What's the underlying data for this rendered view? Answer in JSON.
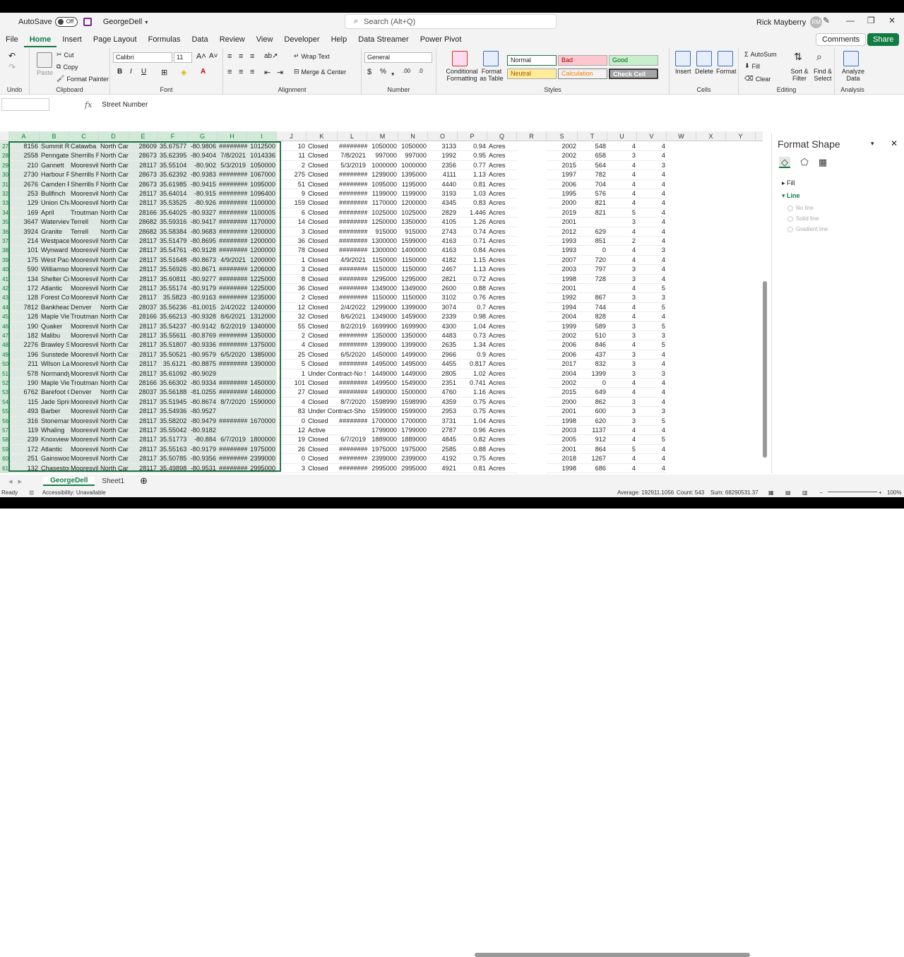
{
  "titlebar": {
    "autosave_label": "AutoSave",
    "autosave_state": "Off",
    "doc_name": "GeorgeDell",
    "search_placeholder": "Search (Alt+Q)",
    "user_name": "Rick Mayberry",
    "user_initials": "RM"
  },
  "tabs": [
    "File",
    "Home",
    "Insert",
    "Page Layout",
    "Formulas",
    "Data",
    "Review",
    "View",
    "Developer",
    "Help",
    "Data Streamer",
    "Power Pivot"
  ],
  "comments_label": "Comments",
  "share_label": "Share",
  "ribbon": {
    "undo": "Undo",
    "paste": "Paste",
    "cut": "Cut",
    "copy": "Copy",
    "format_painter": "Format Painter",
    "clipboard": "Clipboard",
    "font_name": "Calibri",
    "font_size": "11",
    "font": "Font",
    "wrap_text": "Wrap Text",
    "merge_center": "Merge & Center",
    "alignment": "Alignment",
    "number_format": "General",
    "number": "Number",
    "cond_format": "Conditional Formatting",
    "format_as_table": "Format as Table",
    "style_normal": "Normal",
    "style_bad": "Bad",
    "style_good": "Good",
    "style_neutral": "Neutral",
    "style_calculation": "Calculation",
    "style_check": "Check Cell",
    "styles": "Styles",
    "insert": "Insert",
    "delete": "Delete",
    "format": "Format",
    "cells": "Cells",
    "autosum": "AutoSum",
    "fill": "Fill",
    "clear": "Clear",
    "sort_filter": "Sort & Filter",
    "find_select": "Find & Select",
    "editing": "Editing",
    "analyze_data": "Analyze Data",
    "analysis": "Analysis"
  },
  "formula_bar": {
    "fx": "fx",
    "value": "Street Number"
  },
  "columns": [
    "A",
    "B",
    "C",
    "D",
    "E",
    "F",
    "G",
    "H",
    "I",
    "J",
    "K",
    "L",
    "M",
    "N",
    "O",
    "P",
    "Q",
    "R",
    "S",
    "T",
    "U",
    "V",
    "W",
    "X",
    "Y"
  ],
  "rows": [
    {
      "n": "27",
      "a": "8156",
      "b": "Summit Ri",
      "c": "Catawba",
      "d": "North Carc",
      "e": "28609",
      "f": "35.67577",
      "g": "-80.9806",
      "h": "########",
      "i": "1012500",
      "j": "10",
      "k": "Closed",
      "l": "########",
      "m": "1050000",
      "nn": "1050000",
      "o": "3133",
      "p": "0.94",
      "q": "Acres",
      "s": "2002",
      "t": "548",
      "u": "4",
      "v": "4"
    },
    {
      "n": "28",
      "a": "2558",
      "b": "Penngate",
      "c": "Sherrills F",
      "d": "North Carc",
      "e": "28673",
      "f": "35.62395",
      "g": "-80.9404",
      "h": "7/8/2021",
      "i": "1014336",
      "j": "11",
      "k": "Closed",
      "l": "7/8/2021",
      "m": "997000",
      "nn": "997000",
      "o": "1992",
      "p": "0.95",
      "q": "Acres",
      "s": "2002",
      "t": "658",
      "u": "3",
      "v": "4"
    },
    {
      "n": "29",
      "a": "210",
      "b": "Gannett",
      "c": "Mooresvil",
      "d": "North Carc",
      "e": "28117",
      "f": "35.55104",
      "g": "-80.902",
      "h": "5/3/2019",
      "i": "1050000",
      "j": "2",
      "k": "Closed",
      "l": "5/3/2019",
      "m": "1000000",
      "nn": "1000000",
      "o": "2356",
      "p": "0.77",
      "q": "Acres",
      "s": "2015",
      "t": "564",
      "u": "4",
      "v": "3"
    },
    {
      "n": "30",
      "a": "2730",
      "b": "Harbour P",
      "c": "Sherrills F",
      "d": "North Carc",
      "e": "28673",
      "f": "35.62392",
      "g": "-80.9383",
      "h": "########",
      "i": "1067000",
      "j": "275",
      "k": "Closed",
      "l": "########",
      "m": "1299000",
      "nn": "1395000",
      "o": "4111",
      "p": "1.13",
      "q": "Acres",
      "s": "1997",
      "t": "782",
      "u": "4",
      "v": "4"
    },
    {
      "n": "31",
      "a": "2676",
      "b": "Camden P",
      "c": "Sherrills F",
      "d": "North Carc",
      "e": "28673",
      "f": "35.61985",
      "g": "-80.9415",
      "h": "########",
      "i": "1095000",
      "j": "51",
      "k": "Closed",
      "l": "########",
      "m": "1095000",
      "nn": "1195000",
      "o": "4440",
      "p": "0.81",
      "q": "Acres",
      "s": "2006",
      "t": "704",
      "u": "4",
      "v": "4"
    },
    {
      "n": "32",
      "a": "253",
      "b": "Bullfinch",
      "c": "Mooresvil",
      "d": "North Carc",
      "e": "28117",
      "f": "35.64014",
      "g": "-80.915",
      "h": "########",
      "i": "1096400",
      "j": "9",
      "k": "Closed",
      "l": "########",
      "m": "1199000",
      "nn": "1199000",
      "o": "3193",
      "p": "1.03",
      "q": "Acres",
      "s": "1995",
      "t": "576",
      "u": "4",
      "v": "4"
    },
    {
      "n": "33",
      "a": "129",
      "b": "Union Cha",
      "c": "Mooresvil",
      "d": "North Carc",
      "e": "28117",
      "f": "35.53525",
      "g": "-80.926",
      "h": "########",
      "i": "1100000",
      "j": "159",
      "k": "Closed",
      "l": "########",
      "m": "1170000",
      "nn": "1200000",
      "o": "4345",
      "p": "0.83",
      "q": "Acres",
      "s": "2000",
      "t": "821",
      "u": "4",
      "v": "4"
    },
    {
      "n": "34",
      "a": "169",
      "b": "April",
      "c": "Troutman",
      "d": "North Carc",
      "e": "28166",
      "f": "35.64025",
      "g": "-80.9327",
      "h": "########",
      "i": "1100005",
      "j": "6",
      "k": "Closed",
      "l": "########",
      "m": "1025000",
      "nn": "1025000",
      "o": "2829",
      "p": "1.446",
      "q": "Acres",
      "s": "2019",
      "t": "821",
      "u": "5",
      "v": "4"
    },
    {
      "n": "35",
      "a": "3647",
      "b": "Waterviev",
      "c": "Terrell",
      "d": "North Carc",
      "e": "28682",
      "f": "35.59316",
      "g": "-80.9417",
      "h": "########",
      "i": "1170000",
      "j": "14",
      "k": "Closed",
      "l": "########",
      "m": "1250000",
      "nn": "1350000",
      "o": "4105",
      "p": "1.26",
      "q": "Acres",
      "s": "2001",
      "t": "",
      "u": "3",
      "v": "4"
    },
    {
      "n": "36",
      "a": "3924",
      "b": "Granite",
      "c": "Terrell",
      "d": "North Carc",
      "e": "28682",
      "f": "35.58384",
      "g": "-80.9683",
      "h": "########",
      "i": "1200000",
      "j": "3",
      "k": "Closed",
      "l": "########",
      "m": "915000",
      "nn": "915000",
      "o": "2743",
      "p": "0.74",
      "q": "Acres",
      "s": "2012",
      "t": "629",
      "u": "4",
      "v": "4"
    },
    {
      "n": "37",
      "a": "214",
      "b": "Westpace",
      "c": "Mooresvil",
      "d": "North Carc",
      "e": "28117",
      "f": "35.51479",
      "g": "-80.8695",
      "h": "########",
      "i": "1200000",
      "j": "36",
      "k": "Closed",
      "l": "########",
      "m": "1300000",
      "nn": "1599000",
      "o": "4163",
      "p": "0.71",
      "q": "Acres",
      "s": "1993",
      "t": "851",
      "u": "2",
      "v": "4"
    },
    {
      "n": "38",
      "a": "101",
      "b": "Wynward",
      "c": "Mooresvil",
      "d": "North Carc",
      "e": "28117",
      "f": "35.54761",
      "g": "-80.9128",
      "h": "########",
      "i": "1200000",
      "j": "78",
      "k": "Closed",
      "l": "########",
      "m": "1300000",
      "nn": "1400000",
      "o": "4163",
      "p": "0.84",
      "q": "Acres",
      "s": "1993",
      "t": "0",
      "u": "4",
      "v": "3"
    },
    {
      "n": "39",
      "a": "175",
      "b": "West Pace",
      "c": "Mooresvil",
      "d": "North Carc",
      "e": "28117",
      "f": "35.51648",
      "g": "-80.8673",
      "h": "4/9/2021",
      "i": "1200000",
      "j": "1",
      "k": "Closed",
      "l": "4/9/2021",
      "m": "1150000",
      "nn": "1150000",
      "o": "4182",
      "p": "1.15",
      "q": "Acres",
      "s": "2007",
      "t": "720",
      "u": "4",
      "v": "4"
    },
    {
      "n": "40",
      "a": "590",
      "b": "Williamso",
      "c": "Mooresvil",
      "d": "North Carc",
      "e": "28117",
      "f": "35.56926",
      "g": "-80.8671",
      "h": "########",
      "i": "1206000",
      "j": "3",
      "k": "Closed",
      "l": "########",
      "m": "1150000",
      "nn": "1150000",
      "o": "2467",
      "p": "1.13",
      "q": "Acres",
      "s": "2003",
      "t": "797",
      "u": "3",
      "v": "4"
    },
    {
      "n": "41",
      "a": "134",
      "b": "Shelter Co",
      "c": "Mooresvil",
      "d": "North Carc",
      "e": "28117",
      "f": "35.60811",
      "g": "-80.9277",
      "h": "########",
      "i": "1225000",
      "j": "8",
      "k": "Closed",
      "l": "########",
      "m": "1295000",
      "nn": "1295000",
      "o": "2821",
      "p": "0.72",
      "q": "Acres",
      "s": "1998",
      "t": "728",
      "u": "3",
      "v": "4"
    },
    {
      "n": "42",
      "a": "172",
      "b": "Atlantic",
      "c": "Mooresvil",
      "d": "North Carc",
      "e": "28117",
      "f": "35.55174",
      "g": "-80.9179",
      "h": "########",
      "i": "1225000",
      "j": "36",
      "k": "Closed",
      "l": "########",
      "m": "1349000",
      "nn": "1349000",
      "o": "2600",
      "p": "0.88",
      "q": "Acres",
      "s": "2001",
      "t": "",
      "u": "4",
      "v": "5"
    },
    {
      "n": "43",
      "a": "128",
      "b": "Forest Cov",
      "c": "Mooresvil",
      "d": "North Carc",
      "e": "28117",
      "f": "35.5823",
      "g": "-80.9163",
      "h": "########",
      "i": "1235000",
      "j": "2",
      "k": "Closed",
      "l": "########",
      "m": "1150000",
      "nn": "1150000",
      "o": "3102",
      "p": "0.76",
      "q": "Acres",
      "s": "1992",
      "t": "867",
      "u": "3",
      "v": "3"
    },
    {
      "n": "44",
      "a": "7812",
      "b": "Bankhead",
      "c": "Denver",
      "d": "North Carc",
      "e": "28037",
      "f": "35.56236",
      "g": "-81.0015",
      "h": "2/4/2022",
      "i": "1240000",
      "j": "12",
      "k": "Closed",
      "l": "2/4/2022",
      "m": "1299000",
      "nn": "1399000",
      "o": "3074",
      "p": "0.7",
      "q": "Acres",
      "s": "1994",
      "t": "744",
      "u": "4",
      "v": "5"
    },
    {
      "n": "45",
      "a": "128",
      "b": "Maple Vie",
      "c": "Troutman",
      "d": "North Carc",
      "e": "28166",
      "f": "35.66213",
      "g": "-80.9328",
      "h": "8/6/2021",
      "i": "1312000",
      "j": "32",
      "k": "Closed",
      "l": "8/6/2021",
      "m": "1349000",
      "nn": "1459000",
      "o": "2339",
      "p": "0.98",
      "q": "Acres",
      "s": "2004",
      "t": "828",
      "u": "4",
      "v": "4"
    },
    {
      "n": "46",
      "a": "190",
      "b": "Quaker",
      "c": "Mooresvil",
      "d": "North Carc",
      "e": "28117",
      "f": "35.54237",
      "g": "-80.9142",
      "h": "8/2/2019",
      "i": "1340000",
      "j": "55",
      "k": "Closed",
      "l": "8/2/2019",
      "m": "1699900",
      "nn": "1699900",
      "o": "4300",
      "p": "1.04",
      "q": "Acres",
      "s": "1999",
      "t": "589",
      "u": "3",
      "v": "5"
    },
    {
      "n": "47",
      "a": "182",
      "b": "Malibu",
      "c": "Mooresvil",
      "d": "North Carc",
      "e": "28117",
      "f": "35.55611",
      "g": "-80.8769",
      "h": "########",
      "i": "1350000",
      "j": "2",
      "k": "Closed",
      "l": "########",
      "m": "1350000",
      "nn": "1350000",
      "o": "4483",
      "p": "0.73",
      "q": "Acres",
      "s": "2002",
      "t": "510",
      "u": "3",
      "v": "3"
    },
    {
      "n": "48",
      "a": "2276",
      "b": "Brawley S",
      "c": "Mooresvil",
      "d": "North Carc",
      "e": "28117",
      "f": "35.51807",
      "g": "-80.9336",
      "h": "########",
      "i": "1375000",
      "j": "4",
      "k": "Closed",
      "l": "########",
      "m": "1399000",
      "nn": "1399000",
      "o": "2635",
      "p": "1.34",
      "q": "Acres",
      "s": "2006",
      "t": "846",
      "u": "4",
      "v": "5"
    },
    {
      "n": "49",
      "a": "196",
      "b": "Sunstede",
      "c": "Mooresvil",
      "d": "North Carc",
      "e": "28117",
      "f": "35.50521",
      "g": "-80.9579",
      "h": "6/5/2020",
      "i": "1385000",
      "j": "25",
      "k": "Closed",
      "l": "6/5/2020",
      "m": "1450000",
      "nn": "1499000",
      "o": "2966",
      "p": "0.9",
      "q": "Acres",
      "s": "2006",
      "t": "437",
      "u": "3",
      "v": "4"
    },
    {
      "n": "50",
      "a": "211",
      "b": "Wilson Lal",
      "c": "Mooresvil",
      "d": "North Carc",
      "e": "28117",
      "f": "35.6121",
      "g": "-80.8875",
      "h": "########",
      "i": "1390000",
      "j": "5",
      "k": "Closed",
      "l": "########",
      "m": "1495000",
      "nn": "1495000",
      "o": "4455",
      "p": "0.817",
      "q": "Acres",
      "s": "2017",
      "t": "832",
      "u": "3",
      "v": "4"
    },
    {
      "n": "51",
      "a": "578",
      "b": "Normandy",
      "c": "Mooresvil",
      "d": "North Carc",
      "e": "28117",
      "f": "35.61092",
      "g": "-80.9029",
      "h": "",
      "i": "",
      "j": "1",
      "k": "Under Contract-No S",
      "l": "",
      "m": "1449000",
      "nn": "1449000",
      "o": "2805",
      "p": "1.02",
      "q": "Acres",
      "s": "2004",
      "t": "1399",
      "u": "3",
      "v": "3"
    },
    {
      "n": "52",
      "a": "190",
      "b": "Maple Vie",
      "c": "Troutman",
      "d": "North Carc",
      "e": "28166",
      "f": "35.66302",
      "g": "-80.9334",
      "h": "########",
      "i": "1450000",
      "j": "101",
      "k": "Closed",
      "l": "########",
      "m": "1499500",
      "nn": "1549000",
      "o": "2351",
      "p": "0.741",
      "q": "Acres",
      "s": "2002",
      "t": "0",
      "u": "4",
      "v": "4"
    },
    {
      "n": "53",
      "a": "6762",
      "b": "Barefoot C",
      "c": "Denver",
      "d": "North Carc",
      "e": "28037",
      "f": "35.56188",
      "g": "-81.0255",
      "h": "########",
      "i": "1460000",
      "j": "27",
      "k": "Closed",
      "l": "########",
      "m": "1490000",
      "nn": "1500000",
      "o": "4760",
      "p": "1.16",
      "q": "Acres",
      "s": "2015",
      "t": "649",
      "u": "4",
      "v": "4"
    },
    {
      "n": "54",
      "a": "115",
      "b": "Jade Sprin",
      "c": "Mooresvil",
      "d": "North Carc",
      "e": "28117",
      "f": "35.51945",
      "g": "-80.8674",
      "h": "8/7/2020",
      "i": "1590000",
      "j": "4",
      "k": "Closed",
      "l": "8/7/2020",
      "m": "1598990",
      "nn": "1598990",
      "o": "4359",
      "p": "0.75",
      "q": "Acres",
      "s": "2000",
      "t": "862",
      "u": "3",
      "v": "4"
    },
    {
      "n": "55",
      "a": "493",
      "b": "Barber",
      "c": "Mooresvil",
      "d": "North Carc",
      "e": "28117",
      "f": "35.54936",
      "g": "-80.9527",
      "h": "",
      "i": "",
      "j": "83",
      "k": "Under Contract-Show",
      "l": "",
      "m": "1599000",
      "nn": "1599000",
      "o": "2953",
      "p": "0.75",
      "q": "Acres",
      "s": "2001",
      "t": "600",
      "u": "3",
      "v": "3"
    },
    {
      "n": "56",
      "a": "316",
      "b": "Stonemar",
      "c": "Mooresvil",
      "d": "North Carc",
      "e": "28117",
      "f": "35.58202",
      "g": "-80.9479",
      "h": "########",
      "i": "1670000",
      "j": "0",
      "k": "Closed",
      "l": "########",
      "m": "1700000",
      "nn": "1700000",
      "o": "3731",
      "p": "1.04",
      "q": "Acres",
      "s": "1998",
      "t": "620",
      "u": "3",
      "v": "5"
    },
    {
      "n": "57",
      "a": "119",
      "b": "Whaling",
      "c": "Mooresvil",
      "d": "North Carc",
      "e": "28117",
      "f": "35.55042",
      "g": "-80.9182",
      "h": "",
      "i": "",
      "j": "12",
      "k": "Active",
      "l": "",
      "m": "1799000",
      "nn": "1799000",
      "o": "2787",
      "p": "0.96",
      "q": "Acres",
      "s": "2003",
      "t": "1137",
      "u": "4",
      "v": "4"
    },
    {
      "n": "58",
      "a": "239",
      "b": "Knoxview",
      "c": "Mooresvil",
      "d": "North Carc",
      "e": "28117",
      "f": "35.51773",
      "g": "-80.884",
      "h": "6/7/2019",
      "i": "1800000",
      "j": "19",
      "k": "Closed",
      "l": "6/7/2019",
      "m": "1889000",
      "nn": "1889000",
      "o": "4845",
      "p": "0.82",
      "q": "Acres",
      "s": "2005",
      "t": "912",
      "u": "4",
      "v": "5"
    },
    {
      "n": "59",
      "a": "172",
      "b": "Atlantic",
      "c": "Mooresvil",
      "d": "North Carc",
      "e": "28117",
      "f": "35.55163",
      "g": "-80.9179",
      "h": "########",
      "i": "1975000",
      "j": "26",
      "k": "Closed",
      "l": "########",
      "m": "1975000",
      "nn": "1975000",
      "o": "2585",
      "p": "0.88",
      "q": "Acres",
      "s": "2001",
      "t": "864",
      "u": "5",
      "v": "4"
    },
    {
      "n": "60",
      "a": "251",
      "b": "Gainswoo",
      "c": "Mooresvil",
      "d": "North Carc",
      "e": "28117",
      "f": "35.50785",
      "g": "-80.9356",
      "h": "########",
      "i": "2399000",
      "j": "0",
      "k": "Closed",
      "l": "########",
      "m": "2399000",
      "nn": "2399000",
      "o": "4192",
      "p": "0.75",
      "q": "Acres",
      "s": "2018",
      "t": "1267",
      "u": "4",
      "v": "4"
    },
    {
      "n": "61",
      "a": "132",
      "b": "Chasestor",
      "c": "Mooresvil",
      "d": "North Carc",
      "e": "28117",
      "f": "35.49898",
      "g": "-80.9531",
      "h": "########",
      "i": "2995000",
      "j": "3",
      "k": "Closed",
      "l": "########",
      "m": "2995000",
      "nn": "2995000",
      "o": "4921",
      "p": "0.81",
      "q": "Acres",
      "s": "1998",
      "t": "686",
      "u": "4",
      "v": "4"
    }
  ],
  "pane": {
    "title": "Format Shape",
    "fill": "Fill",
    "line": "Line",
    "no_line": "No line",
    "solid_line": "Solid line",
    "gradient_line": "Gradient line"
  },
  "sheets": [
    "GeorgeDell",
    "Sheet1"
  ],
  "status": {
    "ready": "Ready",
    "accessibility": "Accessibility: Unavailable",
    "average": "Average: 192911.1056",
    "count": "Count: 543",
    "sum": "Sum: 68290531.37",
    "zoom": "100%"
  }
}
